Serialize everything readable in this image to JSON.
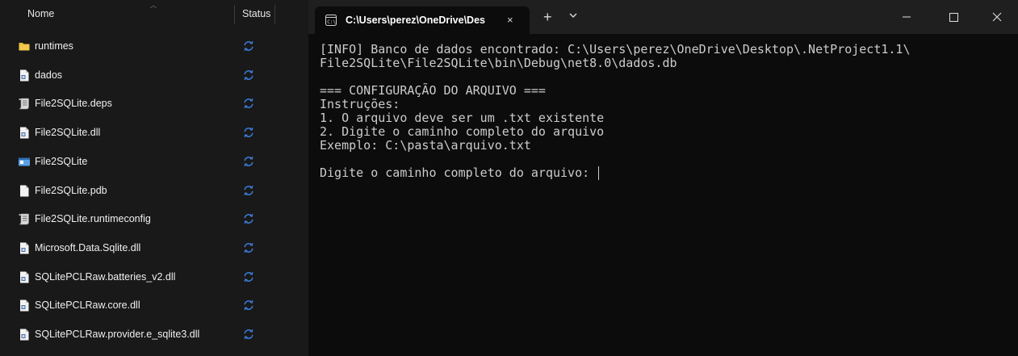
{
  "explorer": {
    "header": {
      "name": "Nome",
      "status": "Status"
    },
    "files": [
      {
        "name": "runtimes",
        "icon": "folder-icon"
      },
      {
        "name": "dados",
        "icon": "file-icon"
      },
      {
        "name": "File2SQLite.deps",
        "icon": "script-file-icon"
      },
      {
        "name": "File2SQLite.dll",
        "icon": "file-icon"
      },
      {
        "name": "File2SQLite",
        "icon": "app-icon"
      },
      {
        "name": "File2SQLite.pdb",
        "icon": "blank-file-icon"
      },
      {
        "name": "File2SQLite.runtimeconfig",
        "icon": "script-file-icon"
      },
      {
        "name": "Microsoft.Data.Sqlite.dll",
        "icon": "file-icon"
      },
      {
        "name": "SQLitePCLRaw.batteries_v2.dll",
        "icon": "file-icon"
      },
      {
        "name": "SQLitePCLRaw.core.dll",
        "icon": "file-icon"
      },
      {
        "name": "SQLitePCLRaw.provider.e_sqlite3.dll",
        "icon": "file-icon"
      }
    ],
    "status_icon": "sync-pending-icon"
  },
  "terminal": {
    "tab_title": "C:\\Users\\perez\\OneDrive\\Des",
    "tab_close": "×",
    "new_tab": "+",
    "lines": [
      "[INFO] Banco de dados encontrado: C:\\Users\\perez\\OneDrive\\Desktop\\.NetProject1.1\\",
      "File2SQLite\\File2SQLite\\bin\\Debug\\net8.0\\dados.db",
      "",
      "=== CONFIGURAÇÃO DO ARQUIVO ===",
      "Instruções:",
      "1. O arquivo deve ser um .txt existente",
      "2. Digite o caminho completo do arquivo",
      "Exemplo: C:\\pasta\\arquivo.txt",
      "",
      "Digite o caminho completo do arquivo: "
    ]
  },
  "colors": {
    "explorer_bg": "#191919",
    "terminal_bg": "#0c0c0c",
    "titlebar_bg": "#1f1f1f",
    "folder": "#e8b93c",
    "sync": "#3a7bd5",
    "console_text": "#cccccc"
  }
}
